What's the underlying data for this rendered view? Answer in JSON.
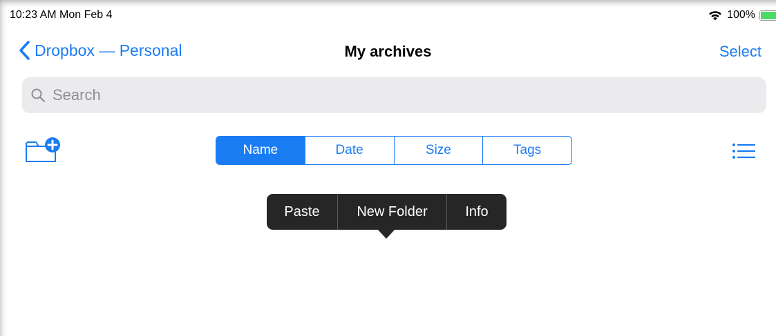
{
  "status_bar": {
    "time": "10:23 AM  Mon Feb 4",
    "battery": "100%",
    "wifi_icon": "wifi-icon",
    "battery_icon": "battery-icon"
  },
  "nav": {
    "back_label": "Dropbox — Personal",
    "title": "My archives",
    "select_label": "Select"
  },
  "search": {
    "placeholder": "Search",
    "value": ""
  },
  "toolbar": {
    "new_folder_icon": "folder-plus-icon",
    "list_icon": "list-icon"
  },
  "sort_tabs": [
    {
      "label": "Name",
      "active": true
    },
    {
      "label": "Date",
      "active": false
    },
    {
      "label": "Size",
      "active": false
    },
    {
      "label": "Tags",
      "active": false
    }
  ],
  "context_menu": {
    "items": [
      "Paste",
      "New Folder",
      "Info"
    ]
  },
  "colors": {
    "accent": "#1a7cf3",
    "menu_bg": "#262626",
    "search_bg": "#ebebee",
    "battery": "#4cd964"
  }
}
